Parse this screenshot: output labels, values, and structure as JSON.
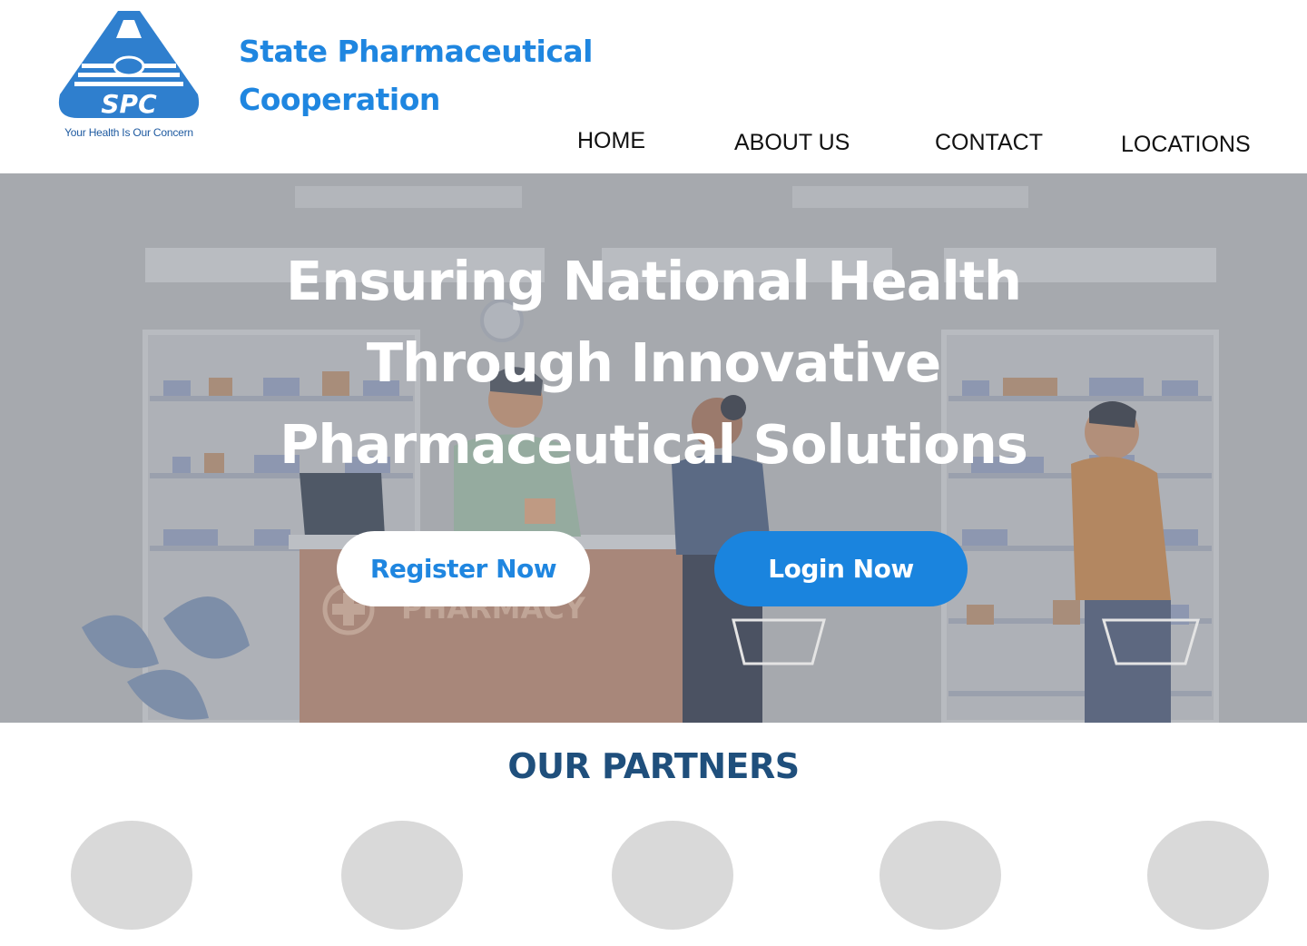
{
  "header": {
    "logo_text": "SPC",
    "logo_tagline": "Your Health Is Our Concern",
    "brand_line1": "State Pharmaceutical",
    "brand_line2": "Cooperation"
  },
  "nav": {
    "home": "HOME",
    "about": "ABOUT US",
    "contact": "CONTACT",
    "locations": "LOCATIONS"
  },
  "hero": {
    "title_line1": "Ensuring National Health",
    "title_line2": "Through Innovative",
    "title_line3": "Pharmaceutical Solutions",
    "register_label": "Register Now",
    "login_label": "Login Now",
    "sign_text": "PHARMACY"
  },
  "partners": {
    "title": "OUR PARTNERS",
    "items": [
      "partner-1",
      "partner-2",
      "partner-3",
      "partner-4",
      "partner-5"
    ]
  },
  "colors": {
    "brand_blue": "#1f86e0",
    "login_blue": "#1a84de",
    "partners_title": "#1f4f7c",
    "placeholder_gray": "#d9d9d9"
  },
  "icons": {
    "logo": "spc-flask-logo-icon",
    "pharmacy_cross": "medical-cross-icon"
  }
}
